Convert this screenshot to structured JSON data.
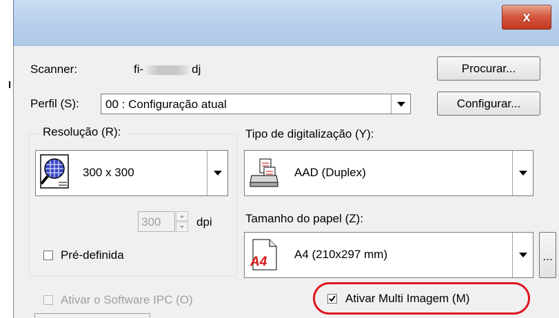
{
  "window": {
    "close_glyph": "x"
  },
  "scanner": {
    "label": "Scanner:",
    "model_prefix": "fi-",
    "model_suffix": "dj",
    "browse_button": "Procurar..."
  },
  "profile": {
    "label": "Perfil (S):",
    "value": "00 : Configuração atual",
    "configure_button": "Configurar..."
  },
  "resolution": {
    "group_label": "Resolução (R):",
    "value": "300 x 300",
    "dpi_value": "300",
    "dpi_unit": "dpi",
    "predefined_label": "Pré-definida",
    "predefined_checked": false
  },
  "scan_type": {
    "label": "Tipo de digitalização (Y):",
    "value": "AAD (Duplex)"
  },
  "paper_size": {
    "label": "Tamanho do papel (Z):",
    "value": "A4 (210x297 mm)",
    "icon_text": "A4",
    "more_button": "..."
  },
  "ipc": {
    "label": "Ativar o Software IPC (O)",
    "checked": false,
    "enabled": false
  },
  "multi_image": {
    "label": "Ativar Multi Imagem (M)",
    "checked": true,
    "highlight_color": "#e0141e"
  }
}
